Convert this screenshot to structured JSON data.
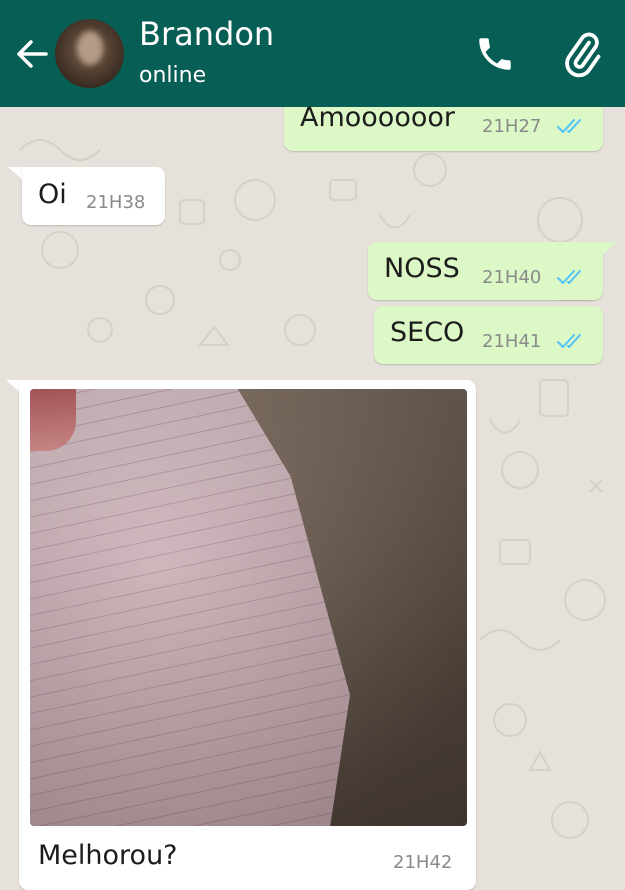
{
  "header": {
    "contact_name": "Brandon",
    "status": "online",
    "icons": [
      "back-arrow-icon",
      "call-icon",
      "paperclip-icon"
    ]
  },
  "messages": [
    {
      "direction": "outgoing",
      "text": "Amoooooor",
      "time": "21H27",
      "read": true
    },
    {
      "direction": "incoming",
      "text": "Oi",
      "time": "21H38"
    },
    {
      "direction": "outgoing",
      "text": "NOSS",
      "time": "21H40",
      "read": true
    },
    {
      "direction": "outgoing",
      "text": "SECO",
      "time": "21H41",
      "read": true
    },
    {
      "direction": "incoming",
      "type": "image",
      "caption": "Melhorou?",
      "time": "21H42"
    }
  ],
  "colors": {
    "header": "#075e54",
    "outgoing_bubble": "#dcf8c6",
    "incoming_bubble": "#ffffff",
    "read_ticks": "#4fc3f7",
    "wallpaper": "#e6e1da"
  }
}
